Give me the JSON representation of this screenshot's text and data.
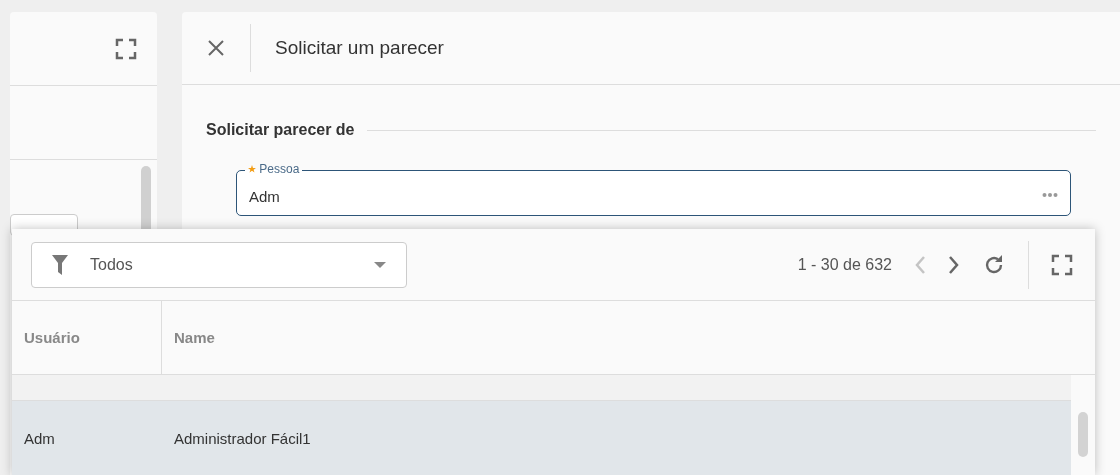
{
  "dialog": {
    "title": "Solicitar um parecer",
    "section_title": "Solicitar parecer de",
    "field": {
      "label": "Pessoa",
      "required": true,
      "value": "Adm"
    }
  },
  "lookup": {
    "filter": {
      "value": "Todos"
    },
    "pagination": "1 - 30 de 632",
    "prev_disabled": true,
    "next_disabled": false,
    "columns": [
      "Usuário",
      "Name"
    ],
    "rows": [
      {
        "cells": [
          "Adm",
          "Administrador Fácil1"
        ],
        "selected": true
      }
    ]
  }
}
